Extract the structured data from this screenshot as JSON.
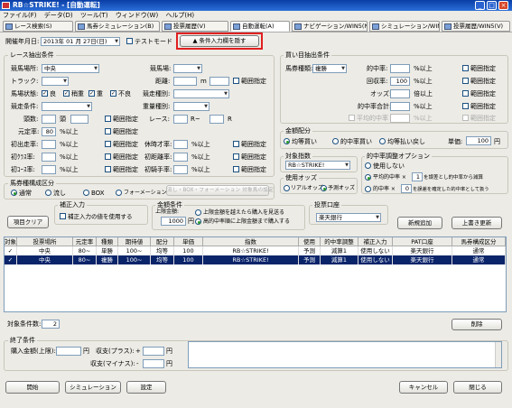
{
  "window": {
    "title": "RB☆STRIKE! - [自動運転]",
    "min": "_",
    "max": "□",
    "close": "×"
  },
  "menu": [
    "ファイル(F)",
    "データ(D)",
    "ツール(T)",
    "ウィンドウ(W)",
    "ヘルプ(H)"
  ],
  "tabs": [
    "レース検索(S)",
    "馬券シミュレーション(B)",
    "投票履歴(V)",
    "自動運転(A)",
    "ナビゲーション/WIN5(N)",
    "シミュレーション/WIN5(S)",
    "投票履歴/WIN5(V)"
  ],
  "top": {
    "date_label": "開催年月日:",
    "date_value": "2013年 01 月 27日(日)",
    "test_mode": "テストモード",
    "toggle_button": "▲ 条件入力欄を隠す"
  },
  "race": {
    "title": "レース抽出条件",
    "place_label": "競馬場所:",
    "place_value": "中央",
    "field_label": "競馬場:",
    "track_label": "トラック:",
    "distance_label": "距離:",
    "distance_unit": "m",
    "range": "範囲指定",
    "condition_label": "馬場状態:",
    "cond_good": "良",
    "cond_yield": "稍重",
    "cond_heavy": "重",
    "cond_bad": "不良",
    "type_label": "競走種別:",
    "race_cond_label": "競走条件:",
    "weight_label": "重量種別:",
    "heads_label": "頭数:",
    "heads_unit": "頭",
    "race_label": "レース:",
    "race_unit1": "R~",
    "race_unit2": "R",
    "top_label": "元定率:",
    "top_value": "80",
    "top_unit": "%以上",
    "first_label": "初出走率:",
    "rest_label": "休時才率:",
    "first_ride_label": "初ｸﾗｽ率:",
    "first_turf_label": "初芝率:",
    "first_dist_label": "初距離率:",
    "first_course_label": "初ｺｰｽ率:",
    "first_jockey_label": "初騎手率:",
    "pct_up": "%以上"
  },
  "bet": {
    "title": "買い目抽出条件",
    "type_label": "馬券種類:",
    "type_value": "複勝",
    "hit_label": "的中率:",
    "hit_unit": "%以上",
    "recovery_label": "回収率:",
    "recovery_value": "100",
    "recovery_unit": "%以上",
    "odds_label": "オッズ:",
    "odds_unit": "倍以上",
    "hitcount_label": "的中率合計:",
    "hitcount_unit": "%以上",
    "avg_label": "平均的中率",
    "avg_unit": "%以上",
    "range": "範囲指定"
  },
  "money": {
    "title": "金額配分",
    "opt1": "均等買い",
    "opt2": "的中率買い",
    "opt3": "均等払い戻し",
    "unit_label": "単価:",
    "unit_value": "100",
    "unit_suffix": "円"
  },
  "index": {
    "title": "対象指数",
    "value": "RB☆STRIKE!"
  },
  "odds_use": {
    "title": "使用オッズ",
    "real": "リアルオッズ",
    "predict": "予測オッズ"
  },
  "hitadj": {
    "title": "的中率調整オプション",
    "opt1": "使用しない",
    "opt2a": "平均的中率 × ",
    "opt2v": "1",
    "opt2b": " を誤差とし的中率から減算",
    "opt3a": "的中率 × ",
    "opt3v": "0",
    "opt3b": " を誤差を確定した的中率として扱う"
  },
  "horse_kind": {
    "title": "馬券種構成区分",
    "opt1": "通常",
    "opt2": "流し",
    "opt3": "BOX",
    "opt4": "フォーメーション",
    "btn": "流し・BOX・フォーメーション 対象馬の設定"
  },
  "correction": {
    "title": "補正入力",
    "check": "補正入力の値を使用する"
  },
  "amount": {
    "title": "金額条件",
    "limit_label": "上限金額:",
    "limit_value": "1000",
    "limit_unit": "円",
    "opt1": "上限金額を越えたら購入を見送る",
    "opt2": "高的中率順に上限金額まで購入する"
  },
  "vote": {
    "title": "投票口座",
    "value": "楽天銀行"
  },
  "buttons": {
    "clear": "項目クリア",
    "add": "新規追加",
    "save": "上書き更新",
    "delete": "削除",
    "start": "開始",
    "sim": "シミュレーション",
    "setting": "設定",
    "cancel": "キャンセル",
    "close": "閉じる"
  },
  "grid": {
    "headers": [
      "対象",
      "投票場所",
      "元定率",
      "種類",
      "期待値",
      "配分",
      "単価",
      "指数",
      "使用",
      "的中率調整",
      "補正入力",
      "PAT口座",
      "馬券構成区分"
    ],
    "rows": [
      [
        "✓",
        "中央",
        "80~",
        "単勝",
        "100~",
        "均等",
        "100",
        "RB☆STRIKE!",
        "予測",
        "減算1",
        "使用しない",
        "楽天銀行",
        "通常"
      ],
      [
        "✓",
        "中央",
        "80~",
        "複勝",
        "100~",
        "均等",
        "100",
        "RB☆STRIKE!",
        "予測",
        "減算1",
        "使用しない",
        "楽天銀行",
        "通常"
      ]
    ]
  },
  "count": {
    "label": "対象条件数:",
    "value": "2"
  },
  "end": {
    "title": "終了条件",
    "buy_label": "購入金額(上限):",
    "buy_unit": "円",
    "plus_label": "収支(プラス):",
    "plus_sign": "+",
    "plus_unit": "円",
    "minus_label": "収支(マイナス):",
    "minus_sign": "-",
    "minus_unit": "円"
  }
}
